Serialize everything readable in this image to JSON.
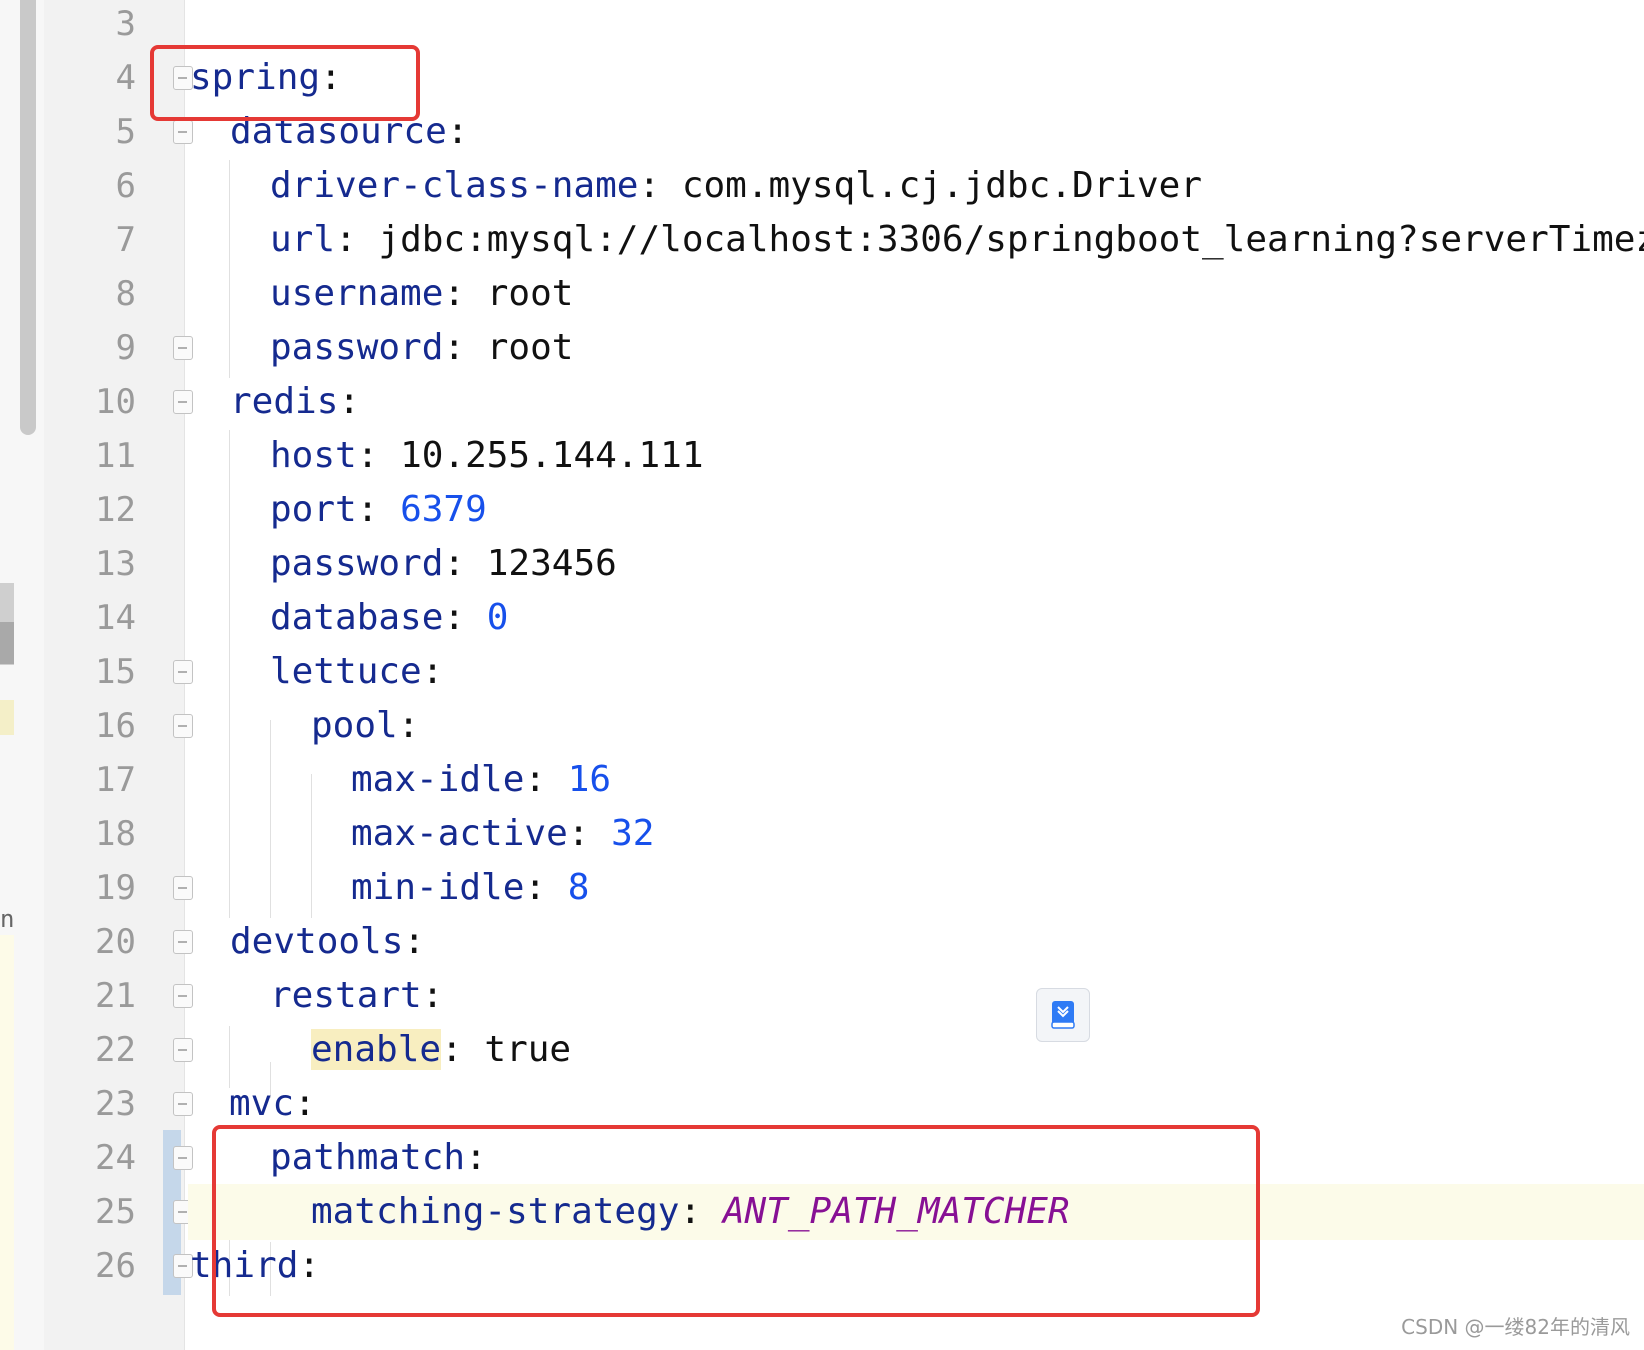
{
  "editor": {
    "lines": [
      {
        "n": "3",
        "parts": []
      },
      {
        "n": "4",
        "parts": [
          {
            "t": "spring",
            "c": "key"
          },
          {
            "t": ":",
            "c": "punct"
          }
        ]
      },
      {
        "n": "5",
        "parts": [
          {
            "t": "datasource",
            "c": "key"
          },
          {
            "t": ":",
            "c": "punct"
          }
        ]
      },
      {
        "n": "6",
        "parts": [
          {
            "t": "driver-class-name",
            "c": "key"
          },
          {
            "t": ": ",
            "c": "punct"
          },
          {
            "t": "com.mysql.cj.jdbc.Driver",
            "c": "val"
          }
        ]
      },
      {
        "n": "7",
        "parts": [
          {
            "t": "url",
            "c": "key"
          },
          {
            "t": ": ",
            "c": "punct"
          },
          {
            "t": "jdbc:mysql://localhost:3306/springboot_learning?serverTimez",
            "c": "val"
          }
        ]
      },
      {
        "n": "8",
        "parts": [
          {
            "t": "username",
            "c": "key"
          },
          {
            "t": ": ",
            "c": "punct"
          },
          {
            "t": "root",
            "c": "val"
          }
        ]
      },
      {
        "n": "9",
        "parts": [
          {
            "t": "password",
            "c": "key"
          },
          {
            "t": ": ",
            "c": "punct"
          },
          {
            "t": "root",
            "c": "val"
          }
        ]
      },
      {
        "n": "10",
        "parts": [
          {
            "t": "redis",
            "c": "key"
          },
          {
            "t": ":",
            "c": "punct"
          }
        ]
      },
      {
        "n": "11",
        "parts": [
          {
            "t": "host",
            "c": "key"
          },
          {
            "t": ": ",
            "c": "punct"
          },
          {
            "t": "10.255.144.111",
            "c": "val"
          }
        ]
      },
      {
        "n": "12",
        "parts": [
          {
            "t": "port",
            "c": "key"
          },
          {
            "t": ": ",
            "c": "punct"
          },
          {
            "t": "6379",
            "c": "num"
          }
        ]
      },
      {
        "n": "13",
        "parts": [
          {
            "t": "password",
            "c": "key"
          },
          {
            "t": ": ",
            "c": "punct"
          },
          {
            "t": "123456",
            "c": "val"
          }
        ]
      },
      {
        "n": "14",
        "parts": [
          {
            "t": "database",
            "c": "key"
          },
          {
            "t": ": ",
            "c": "punct"
          },
          {
            "t": "0",
            "c": "num"
          }
        ]
      },
      {
        "n": "15",
        "parts": [
          {
            "t": "lettuce",
            "c": "key"
          },
          {
            "t": ":",
            "c": "punct"
          }
        ]
      },
      {
        "n": "16",
        "parts": [
          {
            "t": "pool",
            "c": "key"
          },
          {
            "t": ":",
            "c": "punct"
          }
        ]
      },
      {
        "n": "17",
        "parts": [
          {
            "t": "max-idle",
            "c": "key"
          },
          {
            "t": ": ",
            "c": "punct"
          },
          {
            "t": "16",
            "c": "num"
          }
        ]
      },
      {
        "n": "18",
        "parts": [
          {
            "t": "max-active",
            "c": "key"
          },
          {
            "t": ": ",
            "c": "punct"
          },
          {
            "t": "32",
            "c": "num"
          }
        ]
      },
      {
        "n": "19",
        "parts": [
          {
            "t": "min-idle",
            "c": "key"
          },
          {
            "t": ": ",
            "c": "punct"
          },
          {
            "t": "8",
            "c": "num"
          }
        ]
      },
      {
        "n": "20",
        "parts": [
          {
            "t": "devtools",
            "c": "key"
          },
          {
            "t": ":",
            "c": "punct"
          }
        ]
      },
      {
        "n": "21",
        "parts": [
          {
            "t": "restart",
            "c": "key"
          },
          {
            "t": ":",
            "c": "punct"
          }
        ]
      },
      {
        "n": "22",
        "parts": [
          {
            "t": "enable",
            "c": "key enable-hl"
          },
          {
            "t": ": ",
            "c": "punct"
          },
          {
            "t": "true",
            "c": "val"
          }
        ]
      },
      {
        "n": "23",
        "parts": [
          {
            "t": "mvc",
            "c": "key"
          },
          {
            "t": ":",
            "c": "punct"
          }
        ]
      },
      {
        "n": "24",
        "parts": [
          {
            "t": "pathmatch",
            "c": "key"
          },
          {
            "t": ":",
            "c": "punct"
          }
        ]
      },
      {
        "n": "25",
        "parts": [
          {
            "t": "matching-strategy",
            "c": "key"
          },
          {
            "t": ": ",
            "c": "punct"
          },
          {
            "t": "ANT_PATH_MATCHER",
            "c": "enum"
          }
        ]
      },
      {
        "n": "26",
        "parts": [
          {
            "t": "third",
            "c": "key"
          },
          {
            "t": ":",
            "c": "punct"
          }
        ]
      }
    ]
  },
  "left_panel_letter": "n",
  "watermark": "CSDN @一缕82年的清风",
  "colors": {
    "key": "#152a8f",
    "number": "#1750eb",
    "enum": "#871094",
    "highlight_box": "#e53935"
  }
}
